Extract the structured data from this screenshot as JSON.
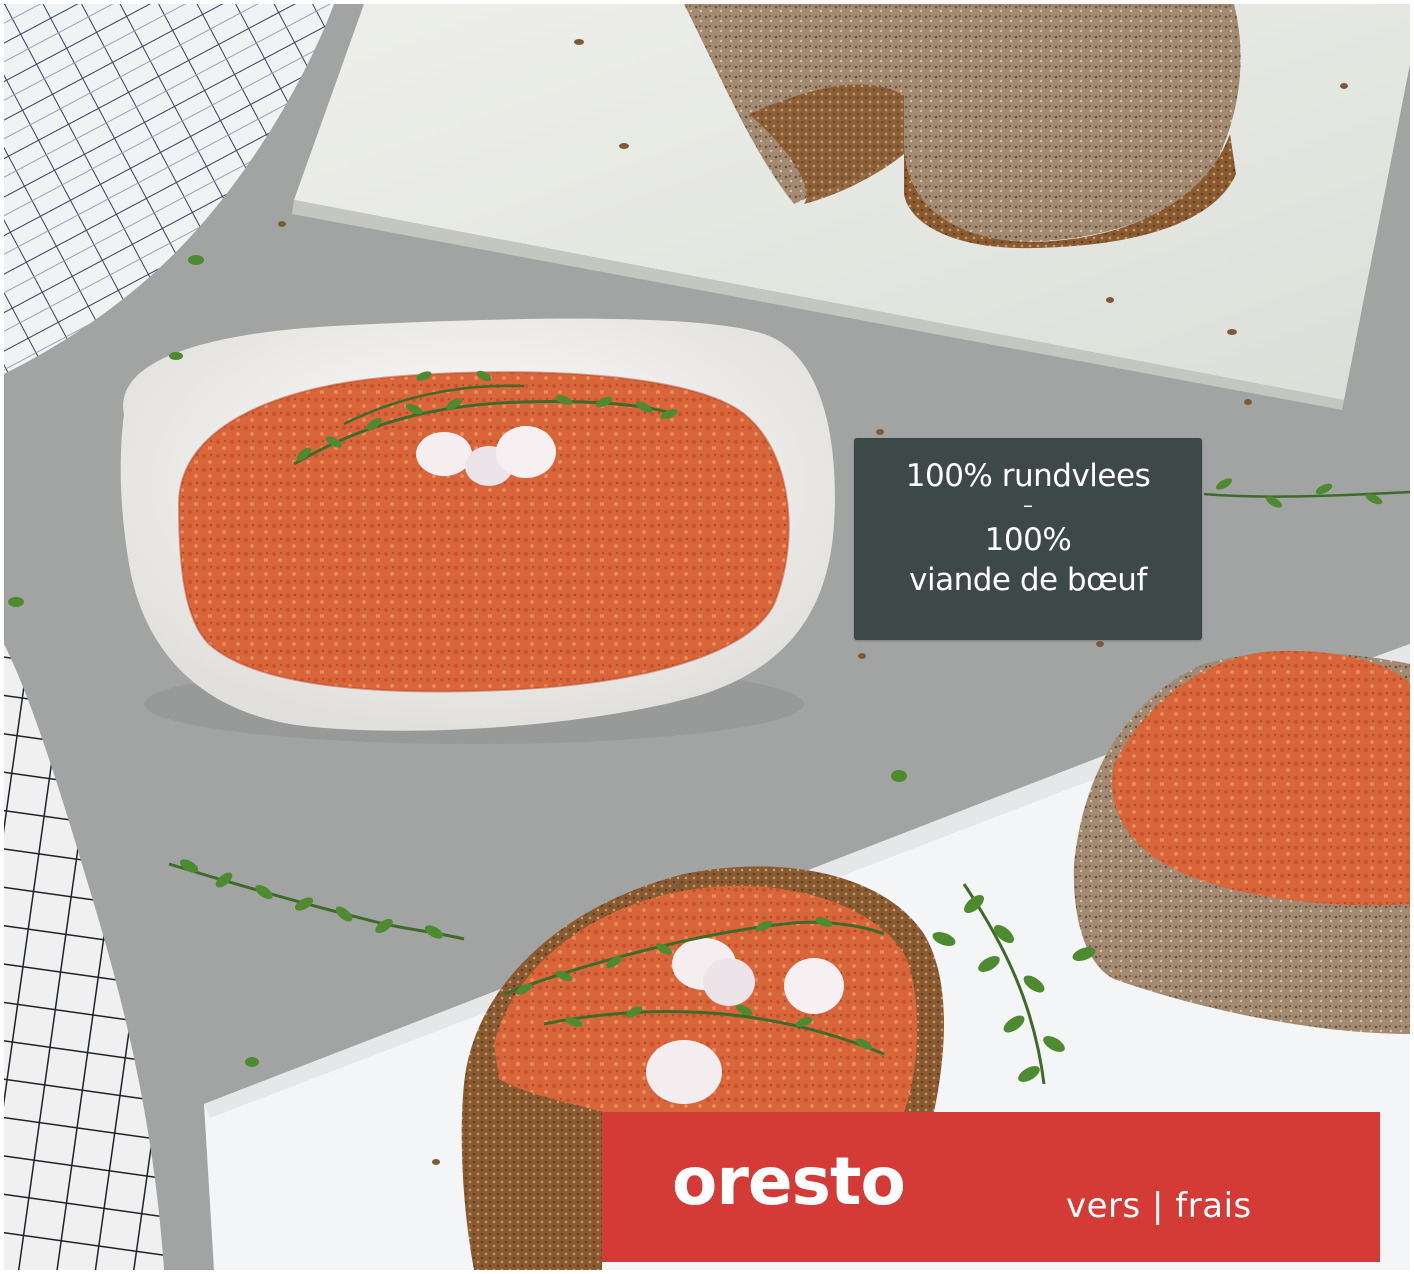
{
  "claim": {
    "line1": "100% rundvlees",
    "separator": "–",
    "line2": "100%",
    "line3": "viande de bœuf"
  },
  "brand": {
    "name": "oresto",
    "tagline": "vers | frais"
  },
  "colors": {
    "brand_red": "#d43a36",
    "claim_box": "#3d4848",
    "spread": "#d9653a",
    "countertop": "#a0a2a2"
  }
}
